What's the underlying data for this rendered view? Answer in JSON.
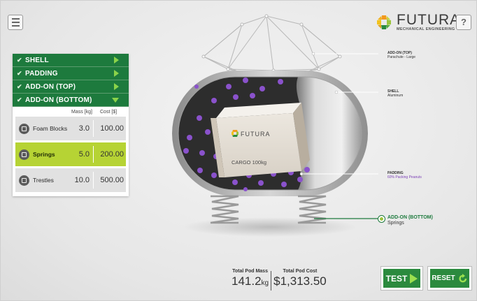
{
  "brand": {
    "name": "FUTURA",
    "subtitle": "MECHANICAL ENGINEERING",
    "accent": "#1d7a3d",
    "highlight": "#b6d334",
    "purple": "#8a52cc"
  },
  "toolbar": {
    "help_label": "?"
  },
  "panel": {
    "categories": [
      {
        "label": "SHELL",
        "state": "collapsed"
      },
      {
        "label": "PADDING",
        "state": "collapsed"
      },
      {
        "label": "ADD-ON (TOP)",
        "state": "collapsed"
      },
      {
        "label": "ADD-ON (BOTTOM)",
        "state": "expanded"
      }
    ],
    "columns": {
      "mass": "Mass [kg]",
      "cost": "Cost [$]"
    },
    "options": [
      {
        "name": "Foam Blocks",
        "mass": "3.0",
        "cost": "100.00",
        "icon": "foam-icon",
        "selected": false
      },
      {
        "name": "Springs",
        "mass": "5.0",
        "cost": "200.00",
        "icon": "spring-icon",
        "selected": true
      },
      {
        "name": "Trestles",
        "mass": "10.0",
        "cost": "500.00",
        "icon": "trestle-icon",
        "selected": false
      }
    ]
  },
  "pod": {
    "cargo_brand": "FUTURA",
    "cargo_label": "CARGO 100kg"
  },
  "callouts": {
    "top": {
      "title": "ADD-ON (TOP)",
      "value": "Parachute - Large"
    },
    "shell": {
      "title": "SHELL",
      "value": "Aluminum"
    },
    "padding": {
      "title": "PADDING",
      "value": "60% Packing Peanuts"
    },
    "bottom": {
      "title": "ADD-ON (BOTTOM)",
      "value": "Springs"
    }
  },
  "totals": {
    "mass_label": "Total Pod Mass",
    "mass_value": "141.2",
    "mass_unit": "kg",
    "cost_label": "Total Pod Cost",
    "cost_value": "$1,313.50"
  },
  "actions": {
    "test_label": "TEST",
    "reset_label": "RESET"
  }
}
